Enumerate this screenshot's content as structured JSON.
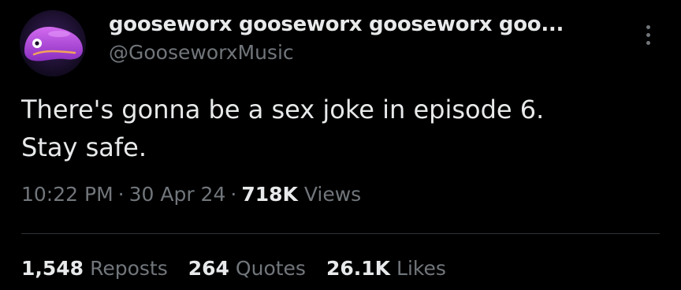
{
  "author": {
    "display_name": "gooseworx gooseworx gooseworx goo...",
    "handle": "@GooseworxMusic",
    "avatar_icon": "purple-creature-avatar"
  },
  "tweet": {
    "lines": [
      "There's gonna be a sex joke in episode 6.",
      "Stay safe."
    ],
    "time": "10:22 PM",
    "date": "30 Apr 24",
    "views_count": "718K",
    "views_label": "Views"
  },
  "stats": {
    "reposts": {
      "count": "1,548",
      "label": "Reposts"
    },
    "quotes": {
      "count": "264",
      "label": "Quotes"
    },
    "likes": {
      "count": "26.1K",
      "label": "Likes"
    }
  },
  "colors": {
    "background": "#000000",
    "primary_text": "#e7e9ea",
    "secondary_text": "#71767b",
    "divider": "#2f3336",
    "avatar_purple": "#b04bdc"
  }
}
